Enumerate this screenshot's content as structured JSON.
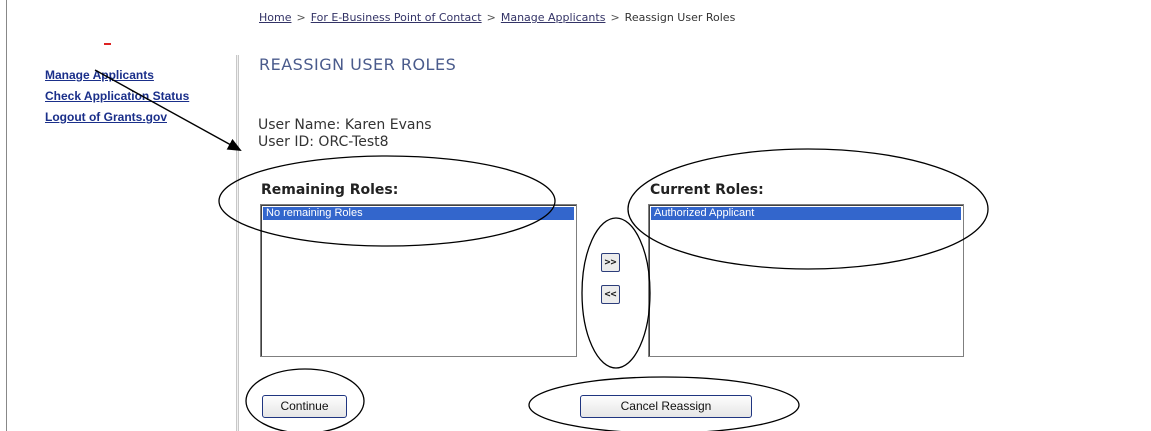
{
  "breadcrumb": {
    "home": "Home",
    "sep": ">",
    "poc": "For E-Business Point of Contact",
    "manage": "Manage Applicants",
    "current": "Reassign User Roles"
  },
  "sidebar": {
    "items": [
      {
        "label": "Manage Applicants"
      },
      {
        "label": "Check Application Status"
      },
      {
        "label": "Logout of Grants.gov"
      }
    ]
  },
  "page": {
    "title": "REASSIGN USER ROLES",
    "user_name": "User Name: Karen Evans",
    "user_id": "User ID: ORC-Test8"
  },
  "roles": {
    "remaining_label": "Remaining Roles:",
    "remaining_items": [
      "No remaining Roles"
    ],
    "current_label": "Current Roles:",
    "current_items": [
      "Authorized Applicant"
    ],
    "add_button": ">>",
    "remove_button": "<<"
  },
  "actions": {
    "continue": "Continue",
    "cancel": "Cancel Reassign"
  },
  "colors": {
    "link": "#1a2f8a",
    "title": "#4a5b8c",
    "selection": "#3366cc"
  }
}
